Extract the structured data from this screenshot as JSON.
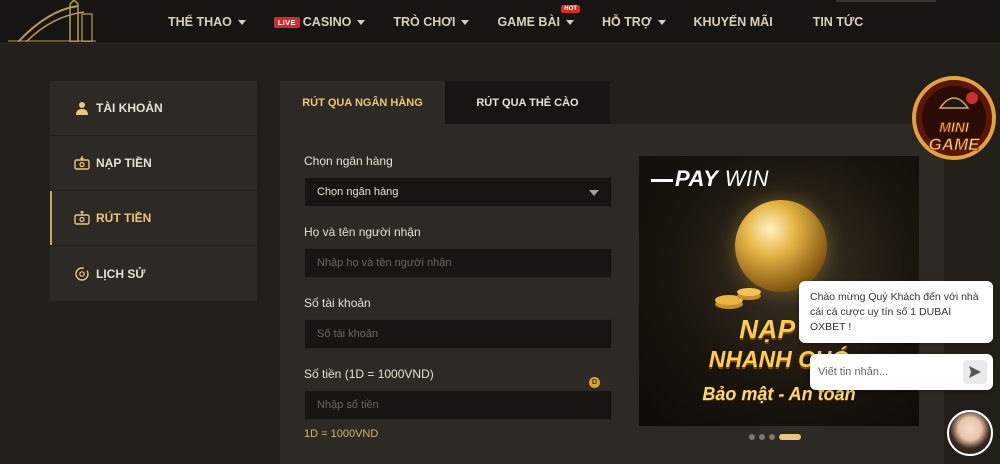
{
  "nav": {
    "items": [
      {
        "label": "THỂ THAO",
        "caret": true
      },
      {
        "badge": "LIVE",
        "label": "CASINO",
        "caret": true
      },
      {
        "label": "TRÒ CHƠI",
        "caret": true
      },
      {
        "label": "GAME BÀI",
        "caret": true,
        "hot": "HOT"
      },
      {
        "label": "HỖ TRỢ",
        "caret": true
      },
      {
        "label": "KHUYẾN MÃI",
        "caret": false
      },
      {
        "label": "TIN TỨC",
        "caret": false
      }
    ]
  },
  "sidebar": {
    "items": [
      {
        "label": "TÀI KHOẢN",
        "icon": "user-icon"
      },
      {
        "label": "NẠP TIỀN",
        "icon": "deposit-icon"
      },
      {
        "label": "RÚT TIỀN",
        "icon": "withdraw-icon",
        "active": true
      },
      {
        "label": "LỊCH SỬ",
        "icon": "history-icon"
      }
    ]
  },
  "tabs": [
    {
      "label": "RÚT QUA NGÂN HÀNG",
      "active": true
    },
    {
      "label": "RÚT QUA THẺ CÀO",
      "active": false
    }
  ],
  "form": {
    "bank_label": "Chọn ngân hàng",
    "bank_value": "Chọn ngân hàng",
    "name_label": "Họ và tên người nhận",
    "name_placeholder": "Nhập họ và tên người nhận",
    "account_label": "Số tài khoản",
    "account_placeholder": "Số tài khoản",
    "amount_label": "Số tiền (1D = 1000VND)",
    "amount_placeholder": "Nhập số tiền",
    "coin_symbol": "D",
    "rate_note": "1D = 1000VND"
  },
  "banner": {
    "brand_pay": "PAY",
    "brand_win": "WIN",
    "line1": "NẠP T",
    "line2": "NHANH CHÓ",
    "line3": "Bảo mật - An toàn",
    "slide_count": 4,
    "active_slide": 4
  },
  "minigame": {
    "line1": "MINI",
    "line2": "GAME"
  },
  "chat": {
    "message": "Chào mừng Quý Khách đến với nhà cái cá cược uy tín số 1 DUBAI OXBET !",
    "input_placeholder": "Viết tin nhắn..."
  },
  "colors": {
    "accent": "#e9c87a",
    "background": "#221f1b",
    "panel": "#2d2a25",
    "live_badge": "#d32a2a"
  }
}
